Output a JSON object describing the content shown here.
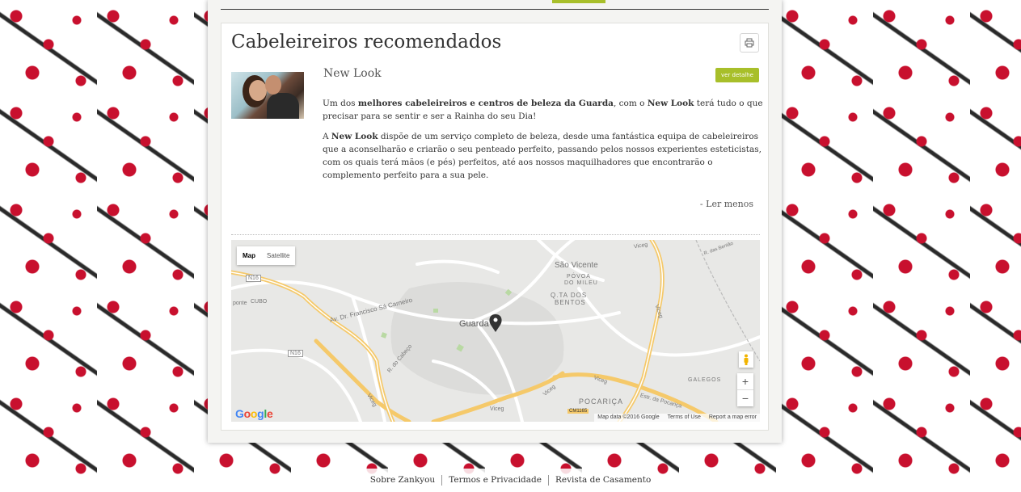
{
  "card": {
    "title": "Cabeleireiros recomendados"
  },
  "salon": {
    "name": "New Look",
    "detail_button": "ver detalhe",
    "desc1_a": "Um dos ",
    "desc1_b": "melhores cabeleireiros e centros de beleza da Guarda",
    "desc1_c": ", com o ",
    "desc1_d": "New Look",
    "desc1_e": " terá tudo o que precisar para se sentir e ser a Rainha do seu Dia!",
    "desc2_a": "A ",
    "desc2_b": "New Look",
    "desc2_c": " dispõe de um serviço completo de beleza, desde uma fantástica equipa de cabeleireiros que a aconselharão e criarão o seu penteado perfeito, passando pelos nossos experientes esteticistas, com os quais terá mãos (e pés) perfeitos, até aos nossos maquilhadores que encontrarão o complemento perfeito para a sua pele.",
    "read_less": "- Ler menos"
  },
  "map": {
    "toggle_map": "Map",
    "toggle_satellite": "Satellite",
    "labels": {
      "sao_vicente": "São Vicente",
      "povoa": "PÓVOA",
      "do_mileu": "DO MILEU",
      "qta": "Q.TA DOS",
      "bentos": "BENTOS",
      "guarda": "Guarda",
      "cubo": "CUBO",
      "ponte": "ponte",
      "n16a": "N16",
      "n16b": "N16",
      "av": "Av. Dr. Francisco Sá Carneiro",
      "rcabeco": "R. do Cabeço",
      "viceg1": "Viceg",
      "viceg2": "Viceg",
      "viceg3": "Viceg",
      "viceg4": "Viceg",
      "viceg5": "Viceg",
      "viceg6": "Viceg",
      "rbentao": "R. das Bentão",
      "galegos": "GALEGOS",
      "pocarica": "POCARIÇA",
      "estr": "Estr. da Pocariça",
      "cm": "CM1165"
    },
    "google": "Google",
    "data": "Map data ©2016 Google",
    "terms": "Terms of Use",
    "report": "Report a map error"
  },
  "footer": {
    "links": [
      "Sobre Zankyou",
      "Termos e Privacidade",
      "Revista de Casamento"
    ]
  },
  "colors": {
    "accent": "#a8bf2a",
    "floral": "#c8102e"
  }
}
